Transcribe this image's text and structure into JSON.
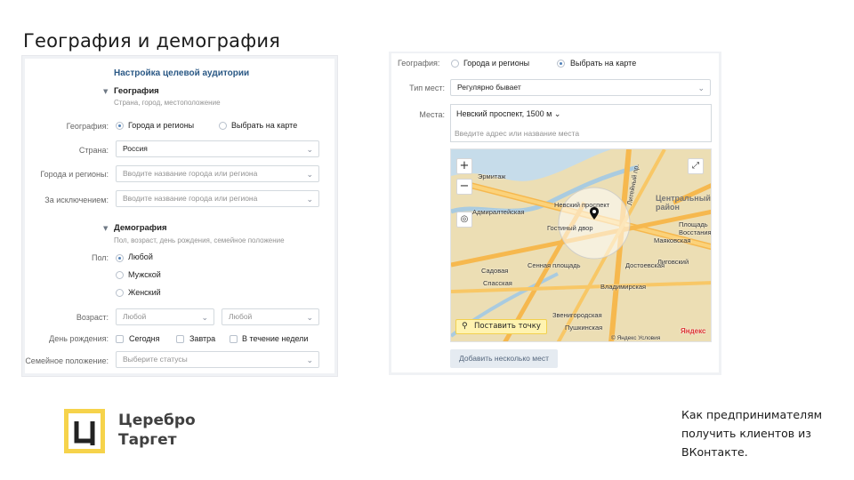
{
  "slide": {
    "title": "География и демография",
    "caption_lines": [
      "Как предпринимателям",
      "получить клиентов из",
      "ВКонтакте."
    ]
  },
  "logo": {
    "line1": "Церебро",
    "line2": "Таргет"
  },
  "audience_form": {
    "header": "Настройка целевой аудитории",
    "geo_section": {
      "title": "География",
      "subtitle": "Страна, город, местоположение"
    },
    "geo_label": "География:",
    "geo_options": [
      "Города и регионы",
      "Выбрать на карте"
    ],
    "country_label": "Страна:",
    "country_value": "Россия",
    "cities_label": "Города и регионы:",
    "cities_placeholder": "Вводите название города или региона",
    "exclude_label": "За исключением:",
    "exclude_placeholder": "Вводите название города или региона",
    "demo_section": {
      "title": "Демография",
      "subtitle": "Пол, возраст, день рождения, семейное положение"
    },
    "gender_label": "Пол:",
    "gender_options": [
      "Любой",
      "Мужской",
      "Женский"
    ],
    "age_label": "Возраст:",
    "age_from": "Любой",
    "age_to": "Любой",
    "birthday_label": "День рождения:",
    "birthday_options": [
      "Сегодня",
      "Завтра",
      "В течение недели"
    ],
    "marital_label": "Семейное положение:",
    "marital_placeholder": "Выберите статусы"
  },
  "map_form": {
    "geo_label": "География:",
    "geo_options": [
      "Города и регионы",
      "Выбрать на карте"
    ],
    "place_type_label": "Тип мест:",
    "place_type_value": "Регулярно бывает",
    "places_label": "Места:",
    "place_tag": "Невский проспект, 1500 м",
    "address_placeholder": "Введите адрес или название места",
    "set_point_button": "Поставить точку",
    "add_several_button": "Добавить несколько мест",
    "map_labels": [
      "Эрмитаж",
      "Адмиралтейская",
      "Невский проспект",
      "Гостиный двор",
      "Литейный пр.",
      "Центральный район",
      "Маяковская",
      "Площадь Восстания",
      "Сенная площадь",
      "Садовая",
      "Спасская",
      "Достоевская",
      "Звенигородская",
      "Пушкинская",
      "Лиговский",
      "Владимирская"
    ],
    "district_label": "Центральный район",
    "attribution": "© Яндекс Условия",
    "yandex_logo": "Яндекс"
  },
  "colors": {
    "accent": "#5181b8",
    "logo_yellow": "#f6d34b",
    "map_bg": "#ecdeb4",
    "road": "#f6b84e"
  }
}
